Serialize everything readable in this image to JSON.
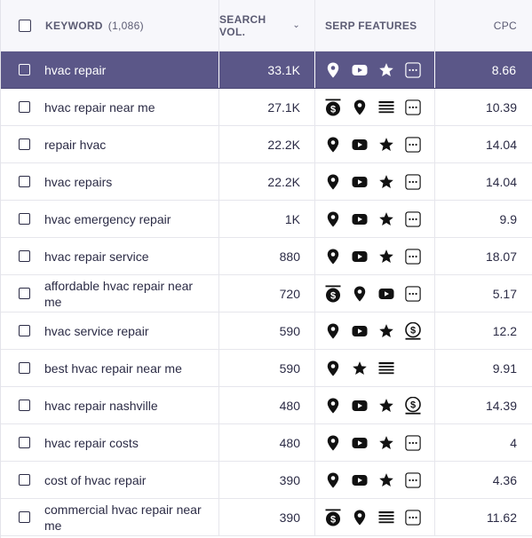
{
  "header": {
    "keyword_label": "KEYWORD",
    "keyword_count": "(1,086)",
    "search_vol_label": "SEARCH VOL.",
    "serp_label": "SERP FEATURES",
    "cpc_label": "CPC"
  },
  "colors": {
    "selected_row_bg": "#5b5788",
    "text": "#2b2b45",
    "header_bg": "#f7f7fb"
  },
  "rows": [
    {
      "keyword": "hvac repair",
      "volume": "33.1K",
      "cpc": "8.66",
      "selected": true,
      "serp": [
        "map-pin-icon",
        "video-icon",
        "star-icon",
        "more-icon"
      ]
    },
    {
      "keyword": "hvac repair near me",
      "volume": "27.1K",
      "cpc": "10.39",
      "selected": false,
      "serp": [
        "ads-top-icon",
        "map-pin-icon",
        "list-icon",
        "more-icon"
      ]
    },
    {
      "keyword": "repair hvac",
      "volume": "22.2K",
      "cpc": "14.04",
      "selected": false,
      "serp": [
        "map-pin-icon",
        "video-icon",
        "star-icon",
        "more-icon"
      ]
    },
    {
      "keyword": "hvac repairs",
      "volume": "22.2K",
      "cpc": "14.04",
      "selected": false,
      "serp": [
        "map-pin-icon",
        "video-icon",
        "star-icon",
        "more-icon"
      ]
    },
    {
      "keyword": "hvac emergency repair",
      "volume": "1K",
      "cpc": "9.9",
      "selected": false,
      "serp": [
        "map-pin-icon",
        "video-icon",
        "star-icon",
        "more-icon"
      ]
    },
    {
      "keyword": "hvac repair service",
      "volume": "880",
      "cpc": "18.07",
      "selected": false,
      "serp": [
        "map-pin-icon",
        "video-icon",
        "star-icon",
        "more-icon"
      ]
    },
    {
      "keyword": "affordable hvac repair near me",
      "volume": "720",
      "cpc": "5.17",
      "selected": false,
      "serp": [
        "ads-top-icon",
        "map-pin-icon",
        "video-icon",
        "more-icon"
      ]
    },
    {
      "keyword": "hvac service repair",
      "volume": "590",
      "cpc": "12.2",
      "selected": false,
      "serp": [
        "map-pin-icon",
        "video-icon",
        "star-icon",
        "ads-bottom-icon"
      ]
    },
    {
      "keyword": "best hvac repair near me",
      "volume": "590",
      "cpc": "9.91",
      "selected": false,
      "serp": [
        "map-pin-icon",
        "star-icon",
        "list-icon"
      ]
    },
    {
      "keyword": "hvac repair nashville",
      "volume": "480",
      "cpc": "14.39",
      "selected": false,
      "serp": [
        "map-pin-icon",
        "video-icon",
        "star-icon",
        "ads-bottom-icon"
      ]
    },
    {
      "keyword": "hvac repair costs",
      "volume": "480",
      "cpc": "4",
      "selected": false,
      "serp": [
        "map-pin-icon",
        "video-icon",
        "star-icon",
        "more-icon"
      ]
    },
    {
      "keyword": "cost of hvac repair",
      "volume": "390",
      "cpc": "4.36",
      "selected": false,
      "serp": [
        "map-pin-icon",
        "video-icon",
        "star-icon",
        "more-icon"
      ]
    },
    {
      "keyword": "commercial hvac repair near me",
      "volume": "390",
      "cpc": "11.62",
      "selected": false,
      "serp": [
        "ads-top-icon",
        "map-pin-icon",
        "list-icon",
        "more-icon"
      ]
    }
  ]
}
